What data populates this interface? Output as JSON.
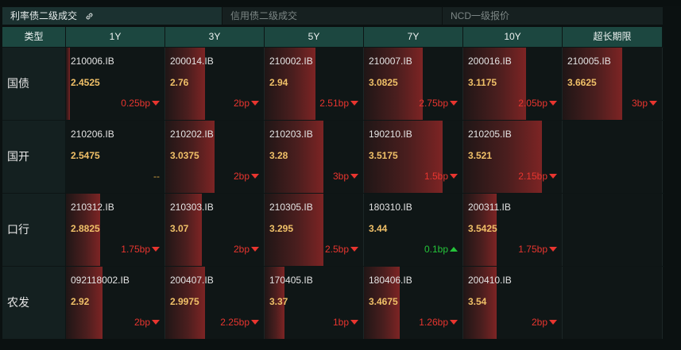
{
  "tabs": [
    {
      "label": "利率债二级成交",
      "active": true
    },
    {
      "label": "信用债二级成交",
      "active": false
    },
    {
      "label": "NCD一级报价",
      "active": false
    }
  ],
  "headers": [
    "类型",
    "1Y",
    "3Y",
    "5Y",
    "7Y",
    "10Y",
    "超长期限"
  ],
  "rows": [
    {
      "label": "国债",
      "cells": [
        {
          "code": "210006.IB",
          "yield": "2.4525",
          "change": "0.25bp",
          "dir": "down",
          "bar": 0.04
        },
        {
          "code": "200014.IB",
          "yield": "2.76",
          "change": "2bp",
          "dir": "down",
          "bar": 0.4
        },
        {
          "code": "210002.IB",
          "yield": "2.94",
          "change": "2.51bp",
          "dir": "down",
          "bar": 0.52
        },
        {
          "code": "210007.IB",
          "yield": "3.0825",
          "change": "2.75bp",
          "dir": "down",
          "bar": 0.6
        },
        {
          "code": "200016.IB",
          "yield": "3.1175",
          "change": "2.05bp",
          "dir": "down",
          "bar": 0.64
        },
        {
          "code": "210005.IB",
          "yield": "3.6625",
          "change": "3bp",
          "dir": "down",
          "bar": 0.6
        }
      ]
    },
    {
      "label": "国开",
      "cells": [
        {
          "code": "210206.IB",
          "yield": "2.5475",
          "change": "--",
          "dir": "none",
          "bar": 0.0
        },
        {
          "code": "210202.IB",
          "yield": "3.0375",
          "change": "2bp",
          "dir": "down",
          "bar": 0.5
        },
        {
          "code": "210203.IB",
          "yield": "3.28",
          "change": "3bp",
          "dir": "down",
          "bar": 0.6
        },
        {
          "code": "190210.IB",
          "yield": "3.5175",
          "change": "1.5bp",
          "dir": "down",
          "bar": 0.8
        },
        {
          "code": "210205.IB",
          "yield": "3.521",
          "change": "2.15bp",
          "dir": "down",
          "bar": 0.8
        },
        null
      ]
    },
    {
      "label": "口行",
      "cells": [
        {
          "code": "210312.IB",
          "yield": "2.8825",
          "change": "1.75bp",
          "dir": "down",
          "bar": 0.35
        },
        {
          "code": "210303.IB",
          "yield": "3.07",
          "change": "2bp",
          "dir": "down",
          "bar": 0.37
        },
        {
          "code": "210305.IB",
          "yield": "3.295",
          "change": "2.5bp",
          "dir": "down",
          "bar": 0.6
        },
        {
          "code": "180310.IB",
          "yield": "3.44",
          "change": "0.1bp",
          "dir": "up",
          "bar": 0.0
        },
        {
          "code": "200311.IB",
          "yield": "3.5425",
          "change": "1.75bp",
          "dir": "down",
          "bar": 0.34
        },
        null
      ]
    },
    {
      "label": "农发",
      "cells": [
        {
          "code": "092118002.IB",
          "yield": "2.92",
          "change": "2bp",
          "dir": "down",
          "bar": 0.37
        },
        {
          "code": "200407.IB",
          "yield": "2.9975",
          "change": "2.25bp",
          "dir": "down",
          "bar": 0.4
        },
        {
          "code": "170405.IB",
          "yield": "3.37",
          "change": "1bp",
          "dir": "down",
          "bar": 0.2
        },
        {
          "code": "180406.IB",
          "yield": "3.4675",
          "change": "1.26bp",
          "dir": "down",
          "bar": 0.36
        },
        {
          "code": "200410.IB",
          "yield": "3.54",
          "change": "2bp",
          "dir": "down",
          "bar": 0.34
        },
        null
      ]
    }
  ]
}
